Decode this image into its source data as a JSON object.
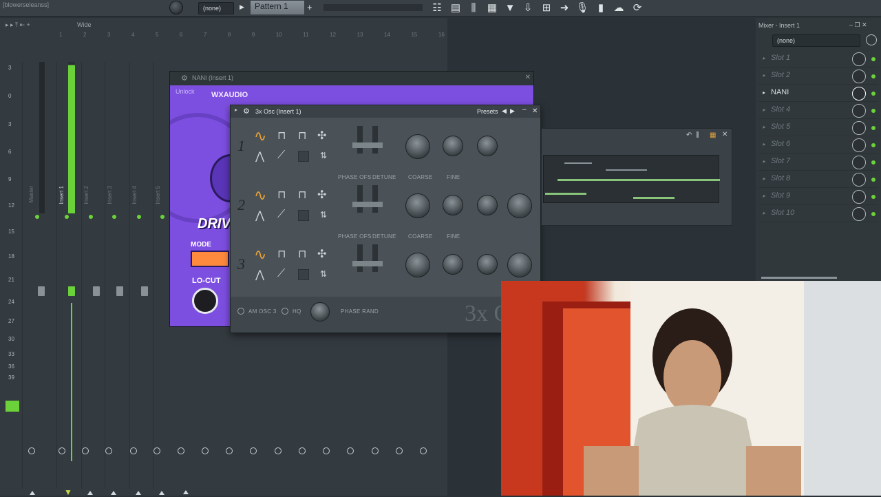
{
  "topbar": {
    "hint": "[blowerseleanss]",
    "preset_value": "(none)",
    "pattern_label": "Pattern 1",
    "pattern_add": "+"
  },
  "mixer": {
    "view_mode": "Wide",
    "bar_ticks": [
      "1",
      "2",
      "3",
      "4",
      "5",
      "6",
      "7",
      "8",
      "9",
      "10",
      "11",
      "12",
      "13",
      "14",
      "15",
      "16"
    ],
    "db_scale": [
      "3",
      "0",
      "3",
      "6",
      "9",
      "12",
      "15",
      "18",
      "21",
      "24",
      "27",
      "30",
      "33",
      "36",
      "39"
    ],
    "tracks": [
      "Master",
      "Insert 1",
      "Insert 2",
      "Insert 3",
      "Insert 4",
      "Insert 5"
    ]
  },
  "nani": {
    "title": "NANI (Insert 1)",
    "unlock_label": "Unlock",
    "brand": "WXAUDIO",
    "drive_label": "DRIV",
    "mode_label": "MODE",
    "locut_label": "LO-CUT"
  },
  "osc": {
    "title": "3x Osc (Insert 1)",
    "presets_label": "Presets",
    "numbers": [
      "1",
      "2",
      "3"
    ],
    "row_labels": {
      "phase_ofs": "PHASE OFS",
      "detune": "DETUNE",
      "coarse": "COARSE",
      "fine": "FINE"
    },
    "am_osc3": "AM OSC 3",
    "hq": "HQ",
    "phase_rand": "PHASE RAND",
    "logo": "3x O"
  },
  "insert_panel": {
    "title": "Mixer - Insert 1",
    "preset": "(none)",
    "slots": [
      "Slot 1",
      "Slot 2",
      "NANI",
      "Slot 4",
      "Slot 5",
      "Slot 6",
      "Slot 7",
      "Slot 8",
      "Slot 9",
      "Slot 10"
    ]
  },
  "colors": {
    "accent_green": "#6bd23a",
    "accent_orange": "#e8a23a",
    "plugin_purple": "#7d4fe0"
  }
}
